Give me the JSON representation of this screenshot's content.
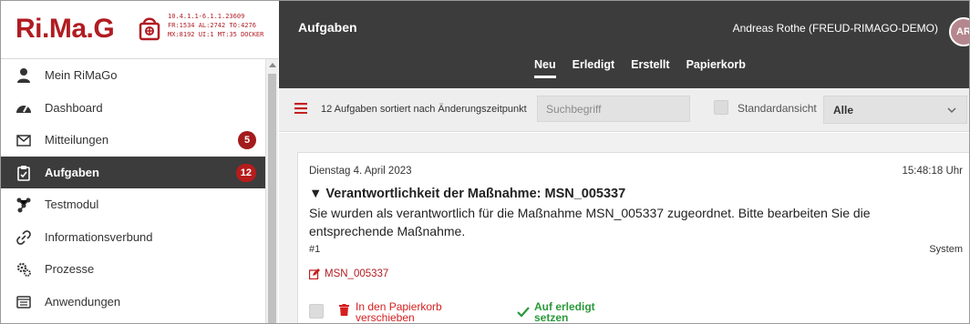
{
  "app": {
    "logo_text": "Ri.Ma.G",
    "sysinfo": "10.4.1.1-6.1.1.23609\nFR:1534 AL:2742 TO:4276\nMX:8192 UI:1 MT:35 DOCKER"
  },
  "header": {
    "title": "Aufgaben",
    "user_name": "Andreas Rothe (FREUD-RIMAGO-DEMO)",
    "avatar_initials": "AR",
    "tabs": [
      {
        "label": "Neu",
        "active": true
      },
      {
        "label": "Erledigt",
        "active": false
      },
      {
        "label": "Erstellt",
        "active": false
      },
      {
        "label": "Papierkorb",
        "active": false
      }
    ]
  },
  "sidebar": {
    "items": [
      {
        "label": "Mein RiMaGo",
        "icon": "user-icon"
      },
      {
        "label": "Dashboard",
        "icon": "gauge-icon"
      },
      {
        "label": "Mitteilungen",
        "icon": "envelope-icon",
        "badge": "5"
      },
      {
        "label": "Aufgaben",
        "icon": "clipboard-check-icon",
        "badge": "12",
        "active": true
      },
      {
        "label": "Testmodul",
        "icon": "network-icon"
      },
      {
        "label": "Informationsverbund",
        "icon": "link-icon"
      },
      {
        "label": "Prozesse",
        "icon": "gears-icon"
      },
      {
        "label": "Anwendungen",
        "icon": "window-list-icon"
      }
    ]
  },
  "toolbar": {
    "sort_text": "12 Aufgaben sortiert nach Änderungszeitpunkt",
    "search_placeholder": "Suchbegriff",
    "std_view_label": "Standardansicht",
    "filter_value": "Alle"
  },
  "task": {
    "date": "Dienstag 4. April 2023",
    "time": "15:48:18 Uhr",
    "title": "▼ Verantwortlichkeit der Maßnahme: MSN_005337",
    "body": "Sie wurden als verantwortlich für die Maßnahme MSN_005337 zugeordnet. Bitte bearbeiten Sie die entsprechende Maßnahme.",
    "number": "#1",
    "source": "System",
    "link_label": "MSN_005337",
    "trash_label_1": "In den Papierkorb",
    "trash_label_2": "verschieben",
    "done_label_1": "Auf erledigt",
    "done_label_2": "setzen"
  },
  "colors": {
    "brand_red": "#b01c22",
    "header_dark": "#3c3c3c",
    "done_green": "#2a9a3a"
  }
}
